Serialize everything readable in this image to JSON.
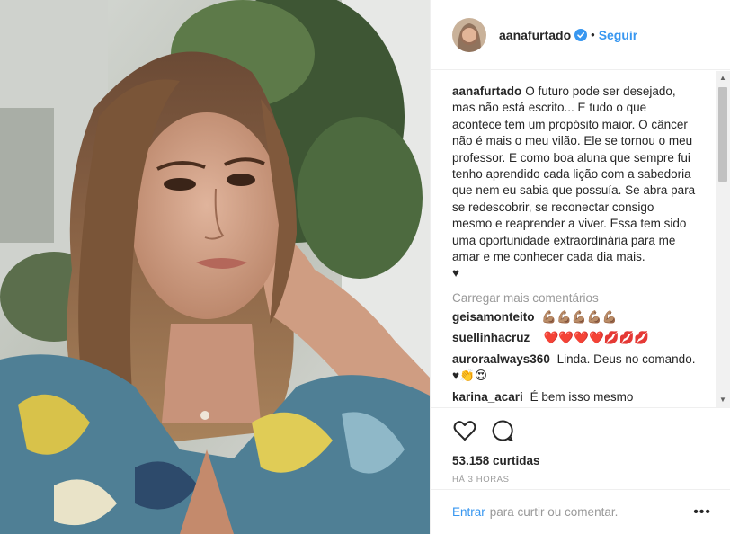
{
  "post": {
    "username": "aanafurtado",
    "follow_label": "Seguir",
    "separator": "•",
    "caption_text": "O futuro pode ser desejado, mas não está escrito... E tudo o que acontece tem um propósito maior. O câncer não é mais o meu vilão. Ele se tornou o meu professor. E como boa aluna que sempre fui tenho aprendido cada lição com a sabedoria que nem eu sabia que possuía. Se abra para se redescobrir, se reconectar consigo mesmo e reaprender a viver. Essa tem sido uma oportunidade extraordinária para me amar e me conhecer cada dia mais.",
    "caption_emoji": "♥",
    "load_more": "Carregar mais comentários",
    "likes": "53.158 curtidas",
    "time": "HÁ 3 HORAS"
  },
  "comments": [
    {
      "user": "geisamonteito",
      "text": "💪🏽💪🏽💪🏽💪🏽💪🏽"
    },
    {
      "user": "suellinhacruz_",
      "text": "❤️❤️❤️❤️💋💋💋"
    },
    {
      "user": "auroraalways360",
      "text": "Linda. Deus no comando. ♥👏😍"
    },
    {
      "user": "karina_acari",
      "text": "É bem isso mesmo"
    }
  ],
  "footer": {
    "enter": "Entrar",
    "rest": "para curtir ou comentar.",
    "more": "•••"
  },
  "colors": {
    "link": "#3897f0",
    "muted": "#999999",
    "text": "#262626"
  },
  "icons": [
    "verified-icon",
    "heart-icon",
    "comment-icon",
    "more-options-icon"
  ]
}
